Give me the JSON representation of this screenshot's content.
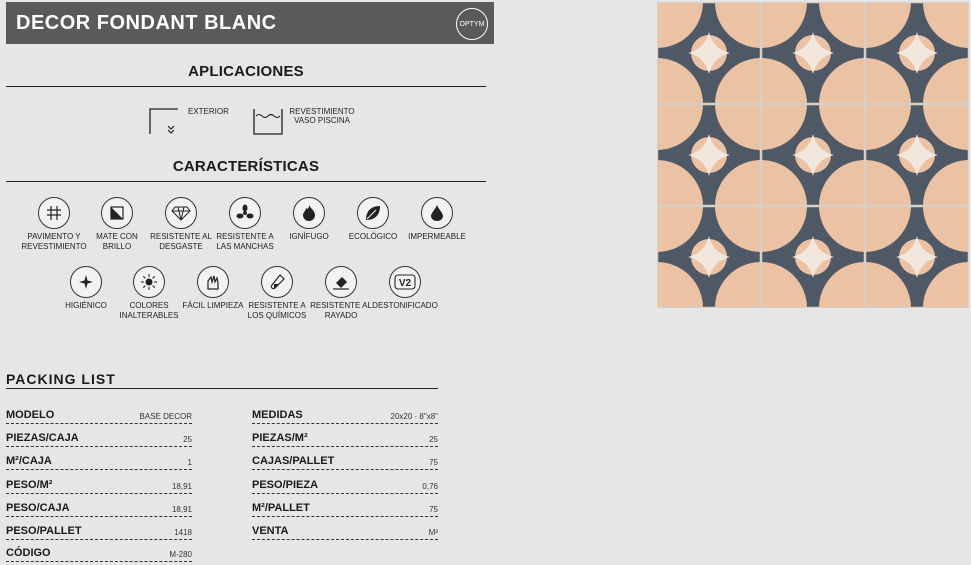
{
  "header": {
    "title": "DECOR FONDANT BLANC",
    "brand": "OPTYM"
  },
  "aplicaciones": {
    "heading": "APLICACIONES",
    "items": [
      {
        "label": "EXTERIOR",
        "icon": "exterior-icon"
      },
      {
        "label": "REVESTIMIENTO VASO PISCINA",
        "icon": "pool-icon"
      }
    ]
  },
  "caracteristicas": {
    "heading": "CARACTERÍSTICAS",
    "row1": [
      {
        "label": "PAVIMENTO Y REVESTIMIENTO",
        "icon": "floor-wall-icon"
      },
      {
        "label": "MATE CON BRILLO",
        "icon": "matte-gloss-icon"
      },
      {
        "label": "RESISTENTE AL DESGASTE",
        "icon": "diamond-icon"
      },
      {
        "label": "RESISTENTE A LAS MANCHAS",
        "icon": "stain-icon"
      },
      {
        "label": "IGNÍFUGO",
        "icon": "flame-icon"
      },
      {
        "label": "ECOLÓGICO",
        "icon": "leaf-icon"
      },
      {
        "label": "IMPERMEABLE",
        "icon": "drop-icon"
      }
    ],
    "row2": [
      {
        "label": "HIGIÉNICO",
        "icon": "hygienic-icon"
      },
      {
        "label": "COLORES INALTERABLES",
        "icon": "sun-icon"
      },
      {
        "label": "FÁCIL LIMPIEZA",
        "icon": "cleaning-icon"
      },
      {
        "label": "RESISTENTE A LOS QUÍMICOS",
        "icon": "chemical-icon"
      },
      {
        "label": "RESISTENTE AL RAYADO",
        "icon": "scratch-icon"
      },
      {
        "label": "DESTONIFICADO",
        "icon": "v2-icon"
      }
    ]
  },
  "packing": {
    "heading": "PACKING LIST",
    "left": [
      {
        "k": "MODELO",
        "v": "BASE DECOR"
      },
      {
        "k": "PIEZAS/CAJA",
        "v": "25"
      },
      {
        "k": "M²/CAJA",
        "v": "1"
      },
      {
        "k": "PESO/M²",
        "v": "18,91"
      },
      {
        "k": "PESO/CAJA",
        "v": "18,91"
      },
      {
        "k": "PESO/PALLET",
        "v": "1418"
      },
      {
        "k": "CÓDIGO",
        "v": "M-280"
      }
    ],
    "right": [
      {
        "k": "MEDIDAS",
        "v": "20x20 · 8\"x8\""
      },
      {
        "k": "PIEZAS/M²",
        "v": "25"
      },
      {
        "k": "CAJAS/PALLET",
        "v": "75"
      },
      {
        "k": "PESO/PIEZA",
        "v": "0,76"
      },
      {
        "k": "M²/PALLET",
        "v": "75"
      },
      {
        "k": "VENTA",
        "v": "M²"
      }
    ]
  },
  "colors": {
    "header_bg": "#5a5a5a",
    "tile_peach": "#ecc2a4",
    "tile_dark": "#4f5865",
    "tile_cream": "#f2e7dc"
  }
}
